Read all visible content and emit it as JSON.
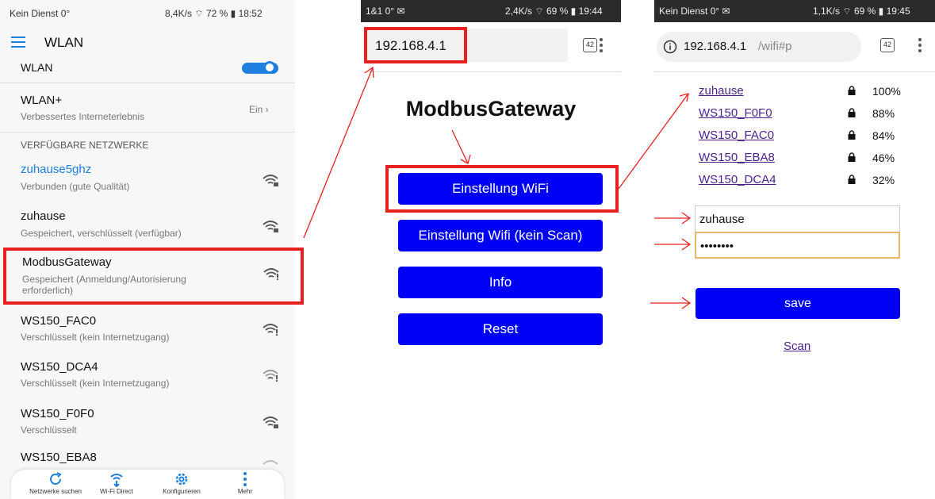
{
  "panel1": {
    "status_left": "Kein Dienst 0°",
    "status_right": "8,4K/s ⌔ 72 % ▮ 18:52",
    "title": "WLAN",
    "wlan_label": "WLAN",
    "wlanplus": {
      "label": "WLAN+",
      "sub": "Verbessertes Interneterlebnis",
      "value": "Ein ›"
    },
    "section_header": "VERFÜGBARE NETZWERKE",
    "networks": [
      {
        "name": "zuhause5ghz",
        "status": "Verbunden (gute Qualität)"
      },
      {
        "name": "zuhause",
        "status": "Gespeichert, verschlüsselt (verfügbar)"
      },
      {
        "name": "ModbusGateway",
        "status": "Gespeichert (Anmeldung/Autorisierung erforderlich)"
      },
      {
        "name": "WS150_FAC0",
        "status": "Verschlüsselt (kein Internetzugang)"
      },
      {
        "name": "WS150_DCA4",
        "status": "Verschlüsselt (kein Internetzugang)"
      },
      {
        "name": "WS150_F0F0",
        "status": "Verschlüsselt"
      },
      {
        "name": "WS150_EBA8",
        "status": ""
      }
    ],
    "bottom_nav": [
      "Netzwerke suchen",
      "Wi-Fi Direct",
      "Konfigurieren",
      "Mehr"
    ],
    "colors": {
      "accent": "#1e7fe0",
      "highlight": "#e8201e"
    }
  },
  "panel2": {
    "status_left": "1&1 0° ✉",
    "status_right": "2,4K/s ⌔ 69 % ▮ 19:44",
    "url": "192.168.4.1",
    "tabs_count": "42",
    "heading": "ModbusGateway",
    "buttons": [
      "Einstellung WiFi",
      "Einstellung Wifi (kein Scan)",
      "Info",
      "Reset"
    ]
  },
  "panel3": {
    "status_left": "Kein Dienst 0° ✉",
    "status_right": "1,1K/s ⌔ 69 % ▮ 19:45",
    "url_host": "192.168.4.1",
    "url_path": "/wifi#p",
    "tabs_count": "42",
    "networks": [
      {
        "name": "zuhause",
        "signal": "100%"
      },
      {
        "name": "WS150_F0F0",
        "signal": "88%"
      },
      {
        "name": "WS150_FAC0",
        "signal": "84%"
      },
      {
        "name": "WS150_EBA8",
        "signal": "46%"
      },
      {
        "name": "WS150_DCA4",
        "signal": "32%"
      }
    ],
    "ssid_value": "zuhause",
    "password_value": "••••••••",
    "save_label": "save",
    "scan_label": "Scan",
    "colors": {
      "button": "#0000f5",
      "link": "#4b1f8f"
    }
  }
}
